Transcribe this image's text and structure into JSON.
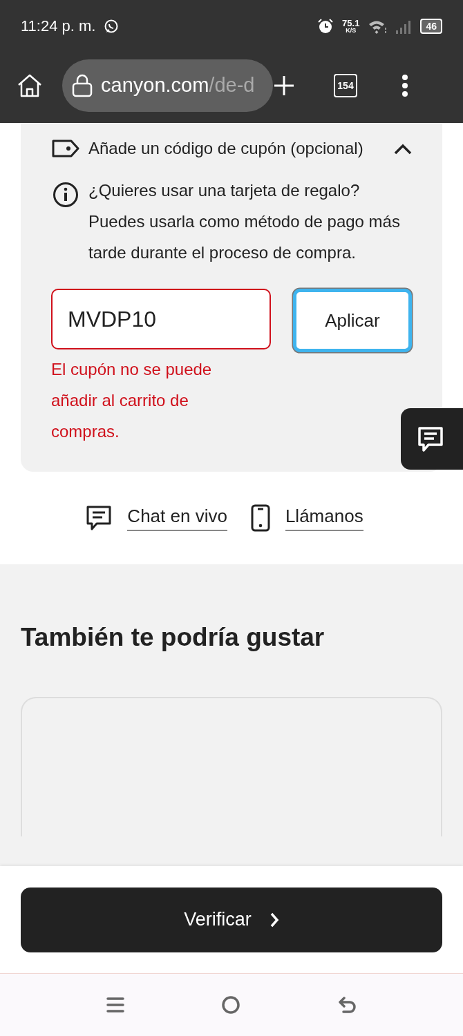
{
  "status_bar": {
    "time": "11:24 p. m.",
    "net_speed": "75.1",
    "net_unit": "K/S",
    "battery": "46"
  },
  "browser": {
    "url_host": "canyon.com",
    "url_path": "/de-d",
    "tab_count": "154"
  },
  "coupon": {
    "title": "Añade un código de cupón (opcional)",
    "expanded": true,
    "info": "¿Quieres usar una tarjeta de regalo? Puedes usarla como método de pago más tarde durante el proceso de compra.",
    "field": {
      "value": "MVDP10",
      "error": true
    },
    "apply_button": {
      "label": "Aplicar",
      "focused": true
    },
    "error_message": "El cupón no se puede añadir al carrito de compras."
  },
  "contact_links": [
    {
      "kind": "chat",
      "label": "Chat en vivo"
    },
    {
      "kind": "phone",
      "label": "Llámanos"
    }
  ],
  "recommendations": {
    "heading": "También te podría gustar"
  },
  "checkout_button": {
    "label": "Verificar"
  }
}
